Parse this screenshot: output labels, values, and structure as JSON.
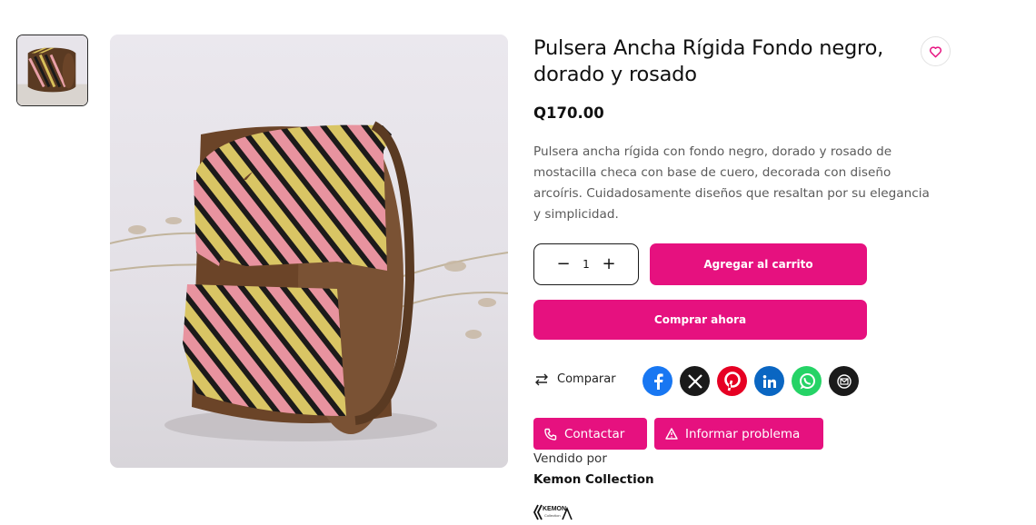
{
  "product": {
    "title": "Pulsera Ancha Rígida Fondo negro, dorado y rosado",
    "price": "Q170.00",
    "description": "Pulsera ancha rígida con fondo negro, dorado y rosado de mostacilla checa con base de cuero, decorada con diseño arcoíris. Cuidadosamente diseños que resaltan por su elegancia y simplicidad."
  },
  "quantity": {
    "value": "1",
    "minus": "−",
    "plus": "+"
  },
  "actions": {
    "add_to_cart": "Agregar al carrito",
    "buy_now": "Comprar ahora",
    "compare": "Comparar",
    "contact": "Contactar",
    "report": "Informar problema"
  },
  "share": {
    "networks": [
      "facebook",
      "x",
      "pinterest",
      "linkedin",
      "whatsapp",
      "email"
    ],
    "colors": {
      "facebook": "#1877f2",
      "x": "#1a1a1a",
      "pinterest": "#e60023",
      "linkedin": "#0a66c2",
      "whatsapp": "#25d366",
      "email": "#1a1a1a"
    }
  },
  "seller": {
    "label": "Vendido por",
    "name": "Kemon Collection",
    "logo_text": "KEMON",
    "logo_subtext": "Collection"
  },
  "colors": {
    "accent": "#e6117f"
  },
  "icons": {
    "wishlist": "heart-icon",
    "compare": "arrows-swap-icon",
    "contact": "phone-icon",
    "report": "warning-icon"
  }
}
